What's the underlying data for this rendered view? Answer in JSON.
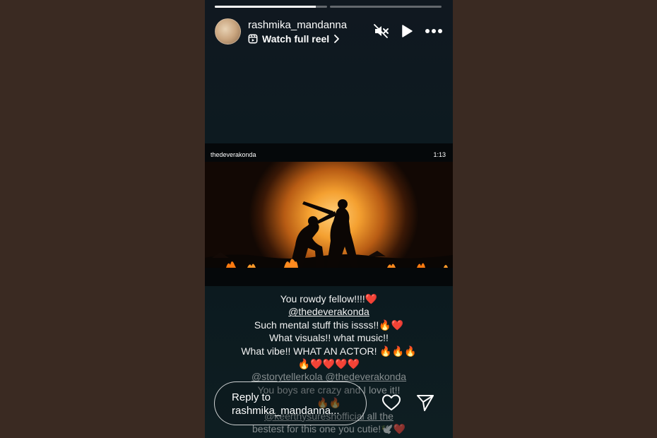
{
  "progress": {
    "segments": [
      {
        "fill": 0.9
      },
      {
        "fill": 0.0
      }
    ]
  },
  "header": {
    "username": "rashmika_mandanna",
    "watch_label": "Watch full reel",
    "icons": [
      "reel-icon",
      "chevron-right-icon",
      "mute-icon",
      "play-icon",
      "more-icon"
    ]
  },
  "video": {
    "account": "thedeverakonda",
    "duration": "1:13"
  },
  "caption": {
    "lines": [
      {
        "text": "You rowdy fellow!!!!❤️",
        "style": "normal"
      },
      {
        "text": "@thedeverakonda",
        "style": "mention"
      },
      {
        "text": "Such mental stuff this issss!!🔥❤️",
        "style": "normal"
      },
      {
        "text": "What visuals!! what music!!",
        "style": "normal"
      },
      {
        "text": "What vibe!! WHAT AN ACTOR! 🔥🔥🔥",
        "style": "normal"
      },
      {
        "text": "🔥❤️❤️❤️❤️",
        "style": "normal"
      },
      {
        "text": "@storytellerkola @thedeverakonda",
        "style": "mention-faded"
      },
      {
        "text": "You boys are crazy and I love it!!",
        "style": "faded"
      },
      {
        "text": "🔥🔥",
        "style": "faded"
      },
      {
        "text": "@keerthysureshofficial all the",
        "style": "mention-faded"
      },
      {
        "text": "bestest for this one you cutie!🕊️❤️",
        "style": "faded"
      }
    ]
  },
  "reply": {
    "line1": "Reply to",
    "line2": "rashmika_mandanna..."
  },
  "actions": {
    "icons": [
      "heart-icon",
      "send-icon"
    ]
  },
  "colors": {
    "background": "#3a2a22",
    "story_bg": "#0d1a20",
    "fire": "#f4a030"
  }
}
